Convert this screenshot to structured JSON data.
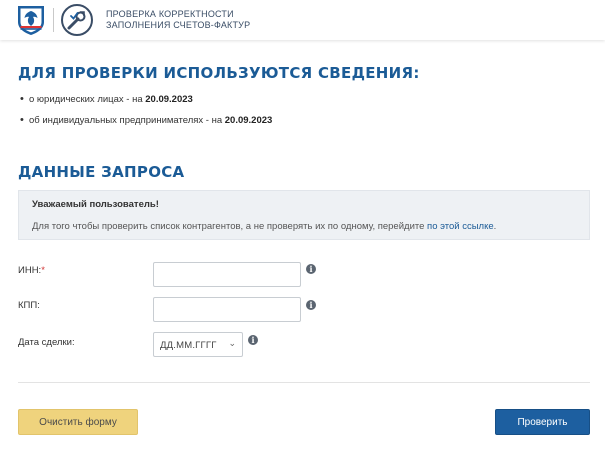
{
  "header": {
    "title_line1": "ПРОВЕРКА КОРРЕКТНОСТИ",
    "title_line2": "ЗАПОЛНЕНИЯ СЧЕТОВ-ФАКТУР"
  },
  "sources": {
    "title": "ДЛЯ ПРОВЕРКИ ИСПОЛЬЗУЮТСЯ СВЕДЕНИЯ:",
    "items": [
      {
        "text": "о юридических лицах - на ",
        "date": "20.09.2023"
      },
      {
        "text": "об индивидуальных предпринимателях - на ",
        "date": "20.09.2023"
      }
    ]
  },
  "request": {
    "title": "ДАННЫЕ ЗАПРОСА",
    "notice_title": "Уважаемый пользователь!",
    "notice_text": "Для того чтобы проверить список контрагентов, а не проверять их по одному, перейдите ",
    "notice_link": "по этой ссылке",
    "notice_end": "."
  },
  "form": {
    "inn_label": "ИНН:",
    "required_mark": "*",
    "inn_value": "",
    "kpp_label": "КПП:",
    "kpp_value": "",
    "date_label": "Дата сделки:",
    "date_placeholder": "ДД.ММ.ГГГГ",
    "info_glyph": "i"
  },
  "buttons": {
    "clear": "Очистить форму",
    "check": "Проверить"
  },
  "colors": {
    "accent": "#1b5b96",
    "primary_button": "#1d5fa0",
    "secondary_button": "#efd37d"
  }
}
